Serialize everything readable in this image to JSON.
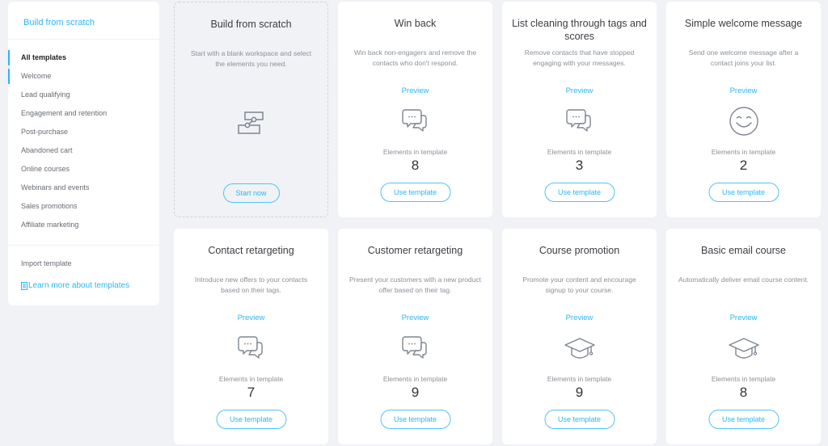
{
  "sidebar": {
    "build_from_scratch": "Build from scratch",
    "nav": [
      {
        "label": "All templates",
        "active": true,
        "bar": true
      },
      {
        "label": "Welcome",
        "active": false,
        "bar": true
      },
      {
        "label": "Lead qualifying"
      },
      {
        "label": "Engagement and retention"
      },
      {
        "label": "Post-purchase"
      },
      {
        "label": "Abandoned cart"
      },
      {
        "label": "Online courses"
      },
      {
        "label": "Webinars and events"
      },
      {
        "label": "Sales promotions"
      },
      {
        "label": "Affiliate marketing"
      }
    ],
    "import_template": "Import template",
    "learn_more": "Learn more about templates",
    "learn_more_icon": "document-icon"
  },
  "scratch_card": {
    "title": "Build from scratch",
    "description": "Start with a blank workspace and select the elements you need.",
    "icon": "workflow-icon",
    "button": "Start now"
  },
  "common": {
    "preview": "Preview",
    "elements_label": "Elements in template",
    "use_template": "Use template"
  },
  "templates": [
    {
      "title": "Win back",
      "description": "Win back non-engagers and remove the contacts who don't respond.",
      "icon": "chat-bubbles-icon",
      "elements": "8"
    },
    {
      "title": "List cleaning through tags and scores",
      "description": "Remove contacts that have stopped engaging with your messages.",
      "icon": "chat-bubbles-icon",
      "elements": "3"
    },
    {
      "title": "Simple welcome message",
      "description": "Send one welcome message after a contact joins your list.",
      "icon": "smiley-icon",
      "elements": "2"
    },
    {
      "title": "Contact retargeting",
      "description": "Introduce new offers to your contacts based on their tags.",
      "icon": "chat-bubbles-icon",
      "elements": "7"
    },
    {
      "title": "Customer retargeting",
      "description": "Present your customers with a new product offer based on their tag.",
      "icon": "chat-bubbles-icon",
      "elements": "9"
    },
    {
      "title": "Course promotion",
      "description": "Promote your content and encourage signup to your course.",
      "icon": "graduation-cap-icon",
      "elements": "9"
    },
    {
      "title": "Basic email course",
      "description": "Automatically deliver email course content.",
      "icon": "graduation-cap-icon",
      "elements": "8"
    }
  ],
  "colors": {
    "accent": "#29b6f6",
    "background": "#f1f2f6",
    "icon": "#7d8590"
  }
}
